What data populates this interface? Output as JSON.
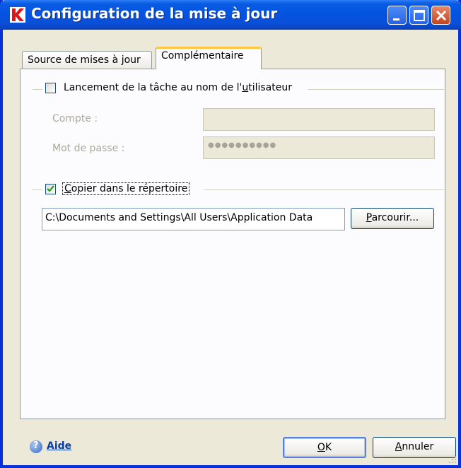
{
  "window": {
    "title": "Configuration de la mise à jour"
  },
  "tabs": [
    {
      "label": "Source de mises à jour"
    },
    {
      "label": "Complémentaire",
      "selected": true
    }
  ],
  "run_as_user": {
    "checkbox_label_pre": "Lancement de la tâche au nom de l'",
    "checkbox_label_mnemonic": "u",
    "checkbox_label_post": "tilisateur",
    "checked": false,
    "account_label": "Compte :",
    "account_value": "",
    "password_label": "Mot de passe :",
    "password_mask": "●●●●●●●●●●"
  },
  "copy_to_dir": {
    "checkbox_label_mnemonic": "C",
    "checkbox_label_post": "opier dans le répertoire",
    "checked": true,
    "path_value": "C:\\Documents and Settings\\All Users\\Application Data",
    "browse_mnemonic": "P",
    "browse_rest": "arcourir..."
  },
  "footer": {
    "help_label": "Aide",
    "ok_mnemonic": "O",
    "ok_rest": "K",
    "cancel_mnemonic": "A",
    "cancel_rest": "nnuler"
  },
  "colors": {
    "title_bar": "#0a5ce3",
    "window_bg": "#ece9d8",
    "tab_highlight": "#ffc83c"
  }
}
